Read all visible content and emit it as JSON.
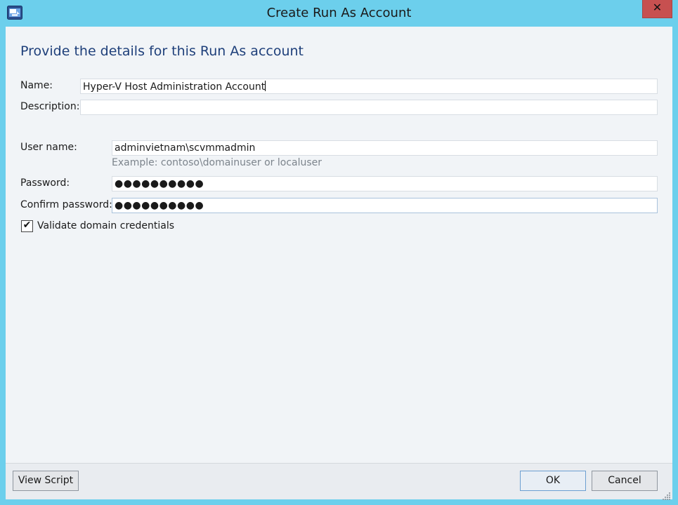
{
  "window": {
    "title": "Create Run As Account",
    "app_icon": "run-as-account-icon",
    "close_glyph": "✕"
  },
  "heading": "Provide the details for this Run As account",
  "form": {
    "name_label": "Name:",
    "name_value": "Hyper-V Host Administration Account",
    "description_label": "Description:",
    "description_value": "",
    "username_label": "User name:",
    "username_value": "adminvietnam\\scvmmadmin",
    "username_hint": "Example: contoso\\domainuser or localuser",
    "password_label": "Password:",
    "password_mask": "●●●●●●●●●●",
    "confirm_label": "Confirm password:",
    "confirm_mask": "●●●●●●●●●●",
    "validate_label": "Validate domain credentials",
    "validate_checked": true,
    "check_glyph": "✔"
  },
  "buttons": {
    "view_script": "View Script",
    "ok": "OK",
    "cancel": "Cancel"
  },
  "colors": {
    "frame": "#6ccfec",
    "close": "#c75050",
    "heading": "#1e3f7a",
    "client": "#f1f4f7"
  }
}
